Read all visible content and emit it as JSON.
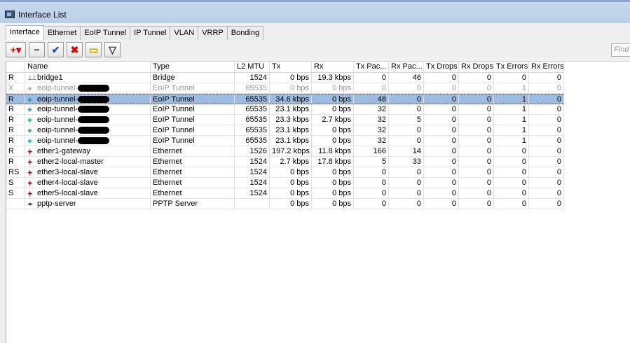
{
  "window": {
    "title": "Interface List"
  },
  "tabs": [
    "Interface",
    "Ethernet",
    "EoIP Tunnel",
    "IP Tunnel",
    "VLAN",
    "VRRP",
    "Bonding"
  ],
  "toolbar": {
    "add": "+▾",
    "remove": "−",
    "enable": "✔",
    "disable": "✖",
    "comment": "▭",
    "filter": "▽"
  },
  "find_placeholder": "Find",
  "columns": [
    "",
    "Name",
    "Type",
    "L2 MTU",
    "Tx",
    "Rx",
    "Tx Pac...",
    "Rx Pac...",
    "Tx Drops",
    "Rx Drops",
    "Tx Errors",
    "Rx Errors"
  ],
  "rows": [
    {
      "flag": "R",
      "icon": "bridge-icon",
      "name": "bridge1",
      "type": "Bridge",
      "mtu": "1524",
      "tx": "0 bps",
      "rx": "19.3 kbps",
      "txp": "0",
      "rxp": "46",
      "txd": "0",
      "rxd": "0",
      "txe": "0",
      "rxe": "0"
    },
    {
      "flag": "X",
      "icon": "eoip-icon",
      "name": "eoip-tunnel-",
      "type": "EoIP Tunnel",
      "mtu": "65535",
      "tx": "0 bps",
      "rx": "0 bps",
      "txp": "0",
      "rxp": "0",
      "txd": "0",
      "rxd": "0",
      "txe": "1",
      "rxe": "0",
      "disabled": true
    },
    {
      "flag": "R",
      "icon": "eoip-icon",
      "name": "eoip-tunnel-",
      "type": "EoIP Tunnel",
      "mtu": "65535",
      "tx": "34.6 kbps",
      "rx": "0 bps",
      "txp": "48",
      "rxp": "0",
      "txd": "0",
      "rxd": "0",
      "txe": "1",
      "rxe": "0",
      "selected": true
    },
    {
      "flag": "R",
      "icon": "eoip-icon",
      "name": "eoip-tunnel-",
      "type": "EoIP Tunnel",
      "mtu": "65535",
      "tx": "23.1 kbps",
      "rx": "0 bps",
      "txp": "32",
      "rxp": "0",
      "txd": "0",
      "rxd": "0",
      "txe": "1",
      "rxe": "0"
    },
    {
      "flag": "R",
      "icon": "eoip-icon",
      "name": "eoip-tunnel-",
      "type": "EoIP Tunnel",
      "mtu": "65535",
      "tx": "23.3 kbps",
      "rx": "2.7 kbps",
      "txp": "32",
      "rxp": "5",
      "txd": "0",
      "rxd": "0",
      "txe": "1",
      "rxe": "0"
    },
    {
      "flag": "R",
      "icon": "eoip-icon",
      "name": "eoip-tunnel-",
      "type": "EoIP Tunnel",
      "mtu": "65535",
      "tx": "23.1 kbps",
      "rx": "0 bps",
      "txp": "32",
      "rxp": "0",
      "txd": "0",
      "rxd": "0",
      "txe": "1",
      "rxe": "0"
    },
    {
      "flag": "R",
      "icon": "eoip-icon",
      "name": "eoip-tunnel-",
      "type": "EoIP Tunnel",
      "mtu": "65535",
      "tx": "23.1 kbps",
      "rx": "0 bps",
      "txp": "32",
      "rxp": "0",
      "txd": "0",
      "rxd": "0",
      "txe": "1",
      "rxe": "0"
    },
    {
      "flag": "R",
      "icon": "ethernet-icon",
      "name": "ether1-gateway",
      "type": "Ethernet",
      "mtu": "1526",
      "tx": "197.2 kbps",
      "rx": "11.8 kbps",
      "txp": "166",
      "rxp": "14",
      "txd": "0",
      "rxd": "0",
      "txe": "0",
      "rxe": "0"
    },
    {
      "flag": "R",
      "icon": "ethernet-icon",
      "name": "ether2-local-master",
      "type": "Ethernet",
      "mtu": "1524",
      "tx": "2.7 kbps",
      "rx": "17.8 kbps",
      "txp": "5",
      "rxp": "33",
      "txd": "0",
      "rxd": "0",
      "txe": "0",
      "rxe": "0"
    },
    {
      "flag": "RS",
      "icon": "ethernet-icon",
      "name": "ether3-local-slave",
      "type": "Ethernet",
      "mtu": "1524",
      "tx": "0 bps",
      "rx": "0 bps",
      "txp": "0",
      "rxp": "0",
      "txd": "0",
      "rxd": "0",
      "txe": "0",
      "rxe": "0"
    },
    {
      "flag": "S",
      "icon": "ethernet-icon",
      "name": "ether4-local-slave",
      "type": "Ethernet",
      "mtu": "1524",
      "tx": "0 bps",
      "rx": "0 bps",
      "txp": "0",
      "rxp": "0",
      "txd": "0",
      "rxd": "0",
      "txe": "0",
      "rxe": "0"
    },
    {
      "flag": "S",
      "icon": "ethernet-icon",
      "name": "ether5-local-slave",
      "type": "Ethernet",
      "mtu": "1524",
      "tx": "0 bps",
      "rx": "0 bps",
      "txp": "0",
      "rxp": "0",
      "txd": "0",
      "rxd": "0",
      "txe": "0",
      "rxe": "0"
    },
    {
      "flag": "",
      "icon": "pptp-icon",
      "name": "pptp-server",
      "type": "PPTP Server",
      "mtu": "",
      "tx": "0 bps",
      "rx": "0 bps",
      "txp": "0",
      "rxp": "0",
      "txd": "0",
      "rxd": "0",
      "txe": "0",
      "rxe": "0"
    }
  ]
}
